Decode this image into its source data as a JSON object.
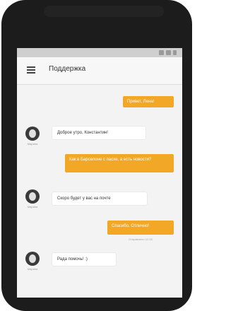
{
  "app": {
    "title": "Поддержка",
    "accent_color": "#f2a726"
  },
  "messages": {
    "m1": {
      "text": "Привет, Лена!"
    },
    "m2": {
      "text": "Доброе утро, Константин!",
      "sender": "Марина"
    },
    "m3": {
      "text": "Как в Барселоне с пасхи, а есть новости?"
    },
    "m4": {
      "text": "Скоро будет у вас на почте",
      "sender": "Марина"
    },
    "m5": {
      "text": "Спасибо. Отлично!",
      "time": "Отправлено 12:18"
    },
    "m6": {
      "text": "Рада помочь! :)",
      "sender": "Марина"
    }
  },
  "icons": {
    "menu": "hamburger-menu-icon",
    "status": [
      "signal-icon",
      "wifi-icon",
      "battery-icon"
    ]
  }
}
